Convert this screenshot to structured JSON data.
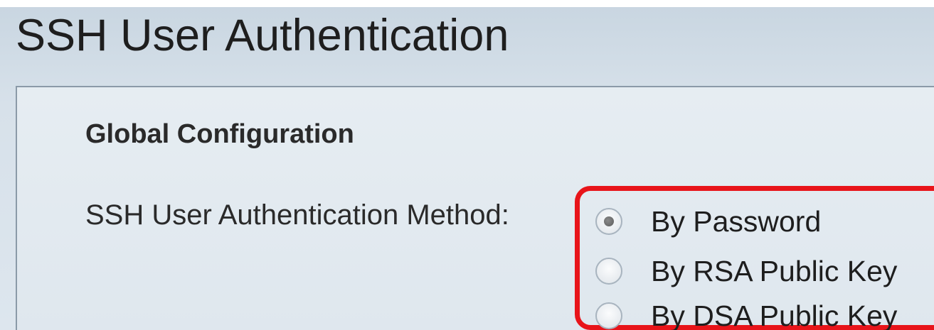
{
  "page": {
    "title": "SSH User Authentication"
  },
  "global_configuration": {
    "section_title": "Global Configuration",
    "method_label": "SSH User Authentication Method:",
    "options": [
      {
        "label": "By Password",
        "selected": true
      },
      {
        "label": "By RSA Public Key",
        "selected": false
      },
      {
        "label": "By DSA Public Key",
        "selected": false
      }
    ],
    "selected_option": "By Password"
  },
  "colors": {
    "highlight_border": "#e8141a",
    "background": "#dbe4ec",
    "text": "#1e1e1e"
  }
}
